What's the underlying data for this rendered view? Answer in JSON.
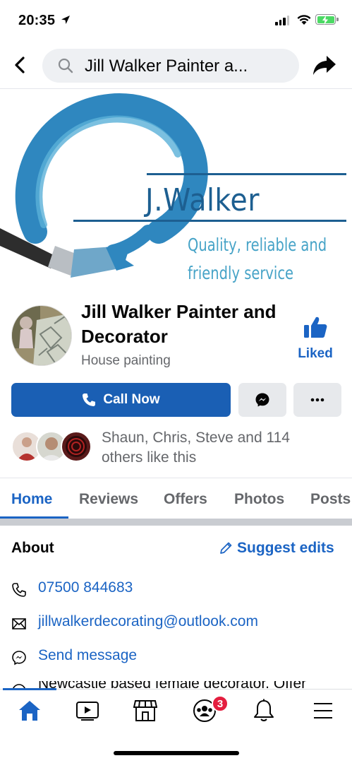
{
  "status_bar": {
    "time": "20:35"
  },
  "nav": {
    "search_text": "Jill Walker Painter a..."
  },
  "cover": {
    "brand": "J.Walker",
    "tagline_line1": "Quality, reliable and",
    "tagline_line2": "friendly service"
  },
  "page": {
    "name": "Jill Walker Painter and Decorator",
    "category": "House painting",
    "liked_label": "Liked"
  },
  "actions": {
    "call_label": "Call Now"
  },
  "likes": {
    "text": "Shaun, Chris, Steve and 114 others like this"
  },
  "tabs": [
    {
      "label": "Home"
    },
    {
      "label": "Reviews"
    },
    {
      "label": "Offers"
    },
    {
      "label": "Photos"
    },
    {
      "label": "Posts"
    }
  ],
  "about": {
    "title": "About",
    "suggest_label": "Suggest edits",
    "phone": "07500 844683",
    "email": "jillwalkerdecorating@outlook.com",
    "message": "Send message",
    "description": "Newcastle based female decorator. Offer"
  },
  "bottom_nav": {
    "groups_badge": "3"
  },
  "colors": {
    "accent": "#1b64c4",
    "call_button": "#1a5fb4",
    "badge": "#e41e3f",
    "brand_dark": "#1d5f91",
    "brand_light": "#46a3c7"
  },
  "icons": {
    "status": [
      "location-arrow-icon",
      "signal-icon",
      "wifi-icon",
      "battery-icon"
    ],
    "nav": [
      "back-icon",
      "search-icon",
      "share-icon"
    ],
    "bottom": [
      "home-icon",
      "watch-icon",
      "marketplace-icon",
      "groups-icon",
      "bell-icon",
      "menu-icon"
    ]
  }
}
